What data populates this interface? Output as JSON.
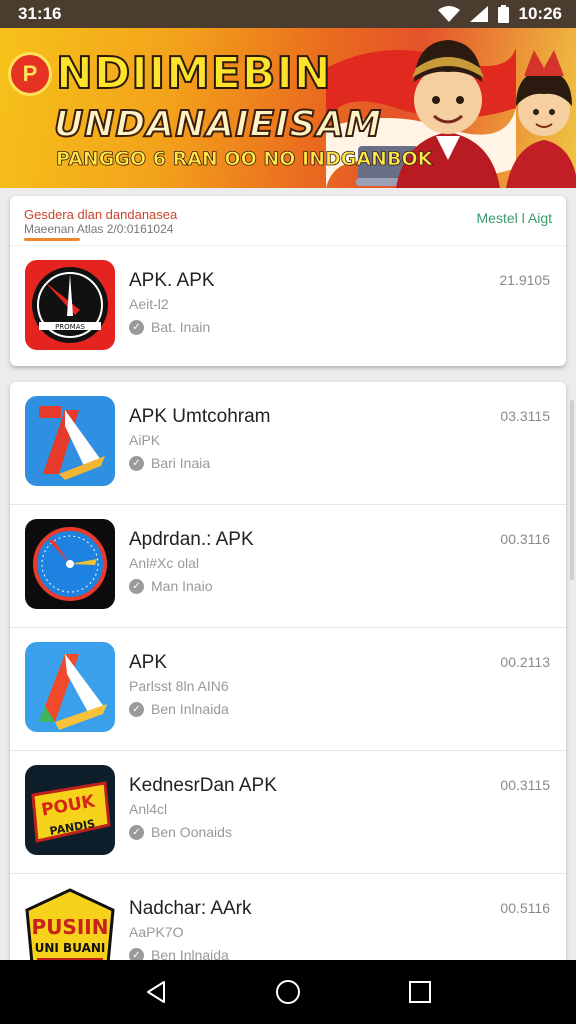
{
  "status_bar": {
    "time": "31:16",
    "clock": "10:26"
  },
  "banner": {
    "logo_glyph": "P",
    "title": "NDIIMEBIN",
    "subtitle": "UNDANAIEISAM",
    "tagline": "PANGGO 6 RAN OO NO INDGANBOK"
  },
  "top_card": {
    "header_title": "Gesdera dlan dandanasea",
    "header_meta": "Maeenan  Atlas 2/0:0161024",
    "header_link": "Mestel l Aigt",
    "app": {
      "name": "APK. APK",
      "sub": "Aeit-l2",
      "status": "Bat. Inain",
      "date": "21.9105",
      "icon": "black-badge-icon"
    }
  },
  "apps": [
    {
      "name": "APK Umtcohram",
      "sub": "AiPK",
      "status": "Bari Inaia",
      "date": "03.3115",
      "icon": "blue-red-a-icon"
    },
    {
      "name": "Apdrdan.: APK",
      "sub": "Anl#Xc olal",
      "status": "Man Inaio",
      "date": "00.3116",
      "icon": "compass-icon"
    },
    {
      "name": "APK",
      "sub": "Parlsst 8ln AIN6",
      "status": "Ben Inlnaida",
      "date": "00.2113",
      "icon": "play-a-icon"
    },
    {
      "name": "KednesrDan APK",
      "sub": "Anl4cl",
      "status": "Ben Oonaids",
      "date": "00.3115",
      "icon": "pouk-badge-icon"
    },
    {
      "name": "Nadchar: AArk",
      "sub": "AaPK7O",
      "status": "Ben Inlnaida",
      "date": "00.5116",
      "icon": "pusiin-badge-icon"
    }
  ],
  "colors": {
    "status_bar": "#4a3c2e",
    "accent_orange": "#f0872b",
    "link_green": "#3a9a6a"
  }
}
